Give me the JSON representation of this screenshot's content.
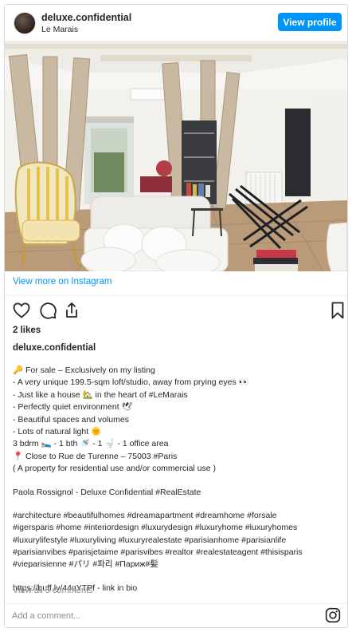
{
  "header": {
    "username": "deluxe.confidential",
    "location": "Le Marais",
    "view_profile_label": "View profile"
  },
  "post": {
    "image_icon": "photo-loft-interior",
    "view_more_label": "View more on Instagram",
    "likes": "2 likes",
    "author": "deluxe.confidential",
    "caption": {
      "line1": "🔑 For sale – Exclusively on my listing",
      "line2": "- A very unique 199.5-sqm loft/studio, away from prying eyes 👀",
      "line3": "- Just like a house 🏡 in the heart of #LeMarais",
      "line4": "- Perfectly quiet environment 🕊",
      "line5": "- Beautiful spaces and volumes",
      "line6": "- Lots of natural light 🌞",
      "line7": "3 bdrm 🛌 - 1 bth 🚿 - 1 🚽 - 1 office area",
      "line8": "📍 Close to Rue de Turenne – 75003 #Paris",
      "line9": "( A property for residential use and/or commercial use )",
      "line10": "Paola Rossignol - Deluxe Confidential #RealEstate",
      "line11": "#architecture #beautifulhomes #dreamapartment #dreamhome #forsale",
      "line12": "#igersparis #home #interiordesign #luxurydesign #luxuryhome #luxuryhomes",
      "line13": "#luxurylifestyle #luxuryliving #luxuryrealestate #parisianhome #parisianlife",
      "line14": "#parisianvibes #parisjetaime #parisvibes #realtor #realestateagent #thisisparis",
      "line15": "#vieparisienne #パリ #파리 #Париж#髪",
      "line16": "https://buff.ly/44qYTPf - link in bio"
    },
    "view_comments": "View all 5 comments"
  },
  "comment_box": {
    "placeholder": "Add a comment..."
  },
  "colors": {
    "accent": "#0095f6",
    "text": "#262626",
    "muted": "#8e8e8e",
    "link": "#00376b",
    "border": "#dbdbdb"
  },
  "icons": [
    "heart-icon",
    "comment-icon",
    "share-icon",
    "bookmark-icon",
    "instagram-icon"
  ]
}
